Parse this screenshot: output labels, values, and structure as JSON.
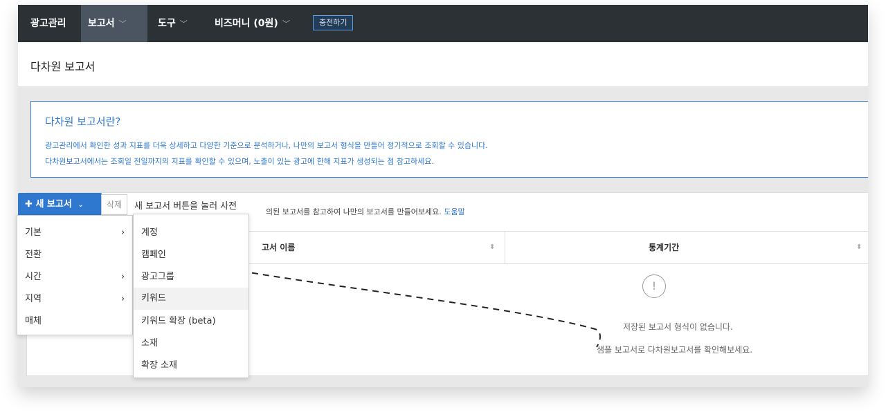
{
  "nav": {
    "items": [
      {
        "label": "광고관리"
      },
      {
        "label": "보고서"
      },
      {
        "label": "도구"
      },
      {
        "label": "비즈머니 (0원)"
      }
    ],
    "charge_label": "충전하기"
  },
  "page_title": "다차원 보고서",
  "info": {
    "title": "다차원 보고서란?",
    "line1": "광고관리에서 확인한 성과 지표를 더욱 상세하고 다양한 기준으로 분석하거나, 나만의 보고서 형식을 만들어 정기적으로 조회할 수 있습니다.",
    "line2": "다차원보고서에서는 조회일 전일까지의 지표를 확인할 수 있으며, 노출이 있는 광고에 한해 지표가 생성되는 점 참고하세요."
  },
  "toolbar": {
    "new_report_label": "새 보고서",
    "delete_label": "삭제",
    "hint_text": "새 보고서 버튼을 눌러 사전",
    "help_text": "의된 보고서를 참고하여 나만의 보고서를 만들어보세요.",
    "help_link": "도움말"
  },
  "table": {
    "columns": [
      {
        "label": "고서 이름"
      },
      {
        "label": "통계기간"
      }
    ],
    "empty_line1": "저장된 보고서 형식이 없습니다.",
    "empty_line2": "샘플 보고서로 다차원보고서를 확인해보세요."
  },
  "menu_primary": [
    {
      "label": "기본",
      "has_sub": true
    },
    {
      "label": "전환",
      "has_sub": false
    },
    {
      "label": "시간",
      "has_sub": true
    },
    {
      "label": "지역",
      "has_sub": true
    },
    {
      "label": "매체",
      "has_sub": false
    }
  ],
  "menu_secondary": [
    {
      "label": "계정"
    },
    {
      "label": "캠페인"
    },
    {
      "label": "광고그룹"
    },
    {
      "label": "키워드"
    },
    {
      "label": "키워드 확장 (beta)"
    },
    {
      "label": "소재"
    },
    {
      "label": "확장 소재"
    }
  ],
  "colors": {
    "nav_bg": "#2c3136",
    "accent": "#2f78d0",
    "info_text": "#2f78d0"
  }
}
